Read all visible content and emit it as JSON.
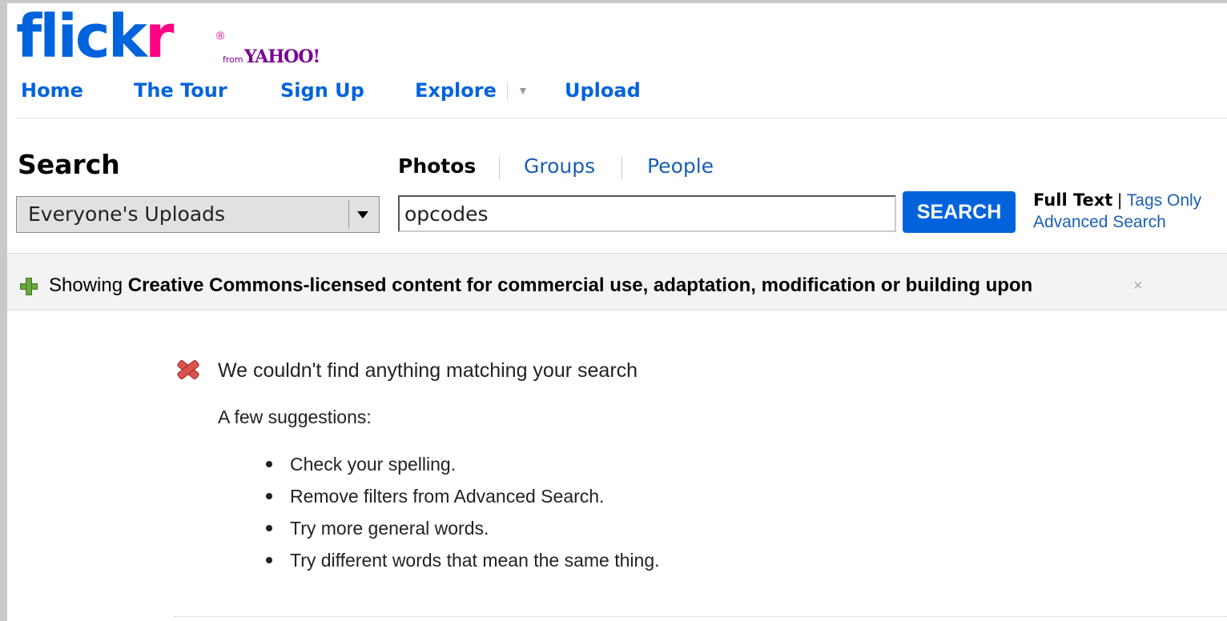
{
  "logo": {
    "flick": "flick",
    "r": "r",
    "registered": "®",
    "from": "from",
    "yahoo": "YAHOO!"
  },
  "nav": {
    "items": [
      {
        "label": "Home"
      },
      {
        "label": "The Tour"
      },
      {
        "label": "Sign Up"
      },
      {
        "label": "Explore"
      },
      {
        "label": "Upload"
      }
    ]
  },
  "search": {
    "title": "Search",
    "tabs": [
      {
        "label": "Photos",
        "active": true
      },
      {
        "label": "Groups",
        "active": false
      },
      {
        "label": "People",
        "active": false
      }
    ],
    "scope": {
      "selected": "Everyone's Uploads"
    },
    "query": "opcodes",
    "button_label": "SEARCH",
    "mode_full_text": "Full Text",
    "mode_separator": "|",
    "mode_tags_only": "Tags Only",
    "advanced_link": "Advanced Search"
  },
  "filter": {
    "prefix": "Showing",
    "text": "Creative Commons-licensed content for commercial use, adaptation, modification or building upon",
    "close": "×"
  },
  "results": {
    "message": "We couldn't find anything matching your search",
    "suggestions_title": "A few suggestions:",
    "suggestions": [
      "Check your spelling.",
      "Remove filters from Advanced Search.",
      "Try more general words.",
      "Try different words that mean the same thing."
    ]
  },
  "icons": {
    "nav_dropdown": "chevron-down-icon",
    "filter_add": "plus-icon",
    "no_results": "error-x-icon"
  },
  "colors": {
    "flickr_blue": "#0063dc",
    "flickr_pink": "#ff0084",
    "yahoo_purple": "#7b0099"
  }
}
